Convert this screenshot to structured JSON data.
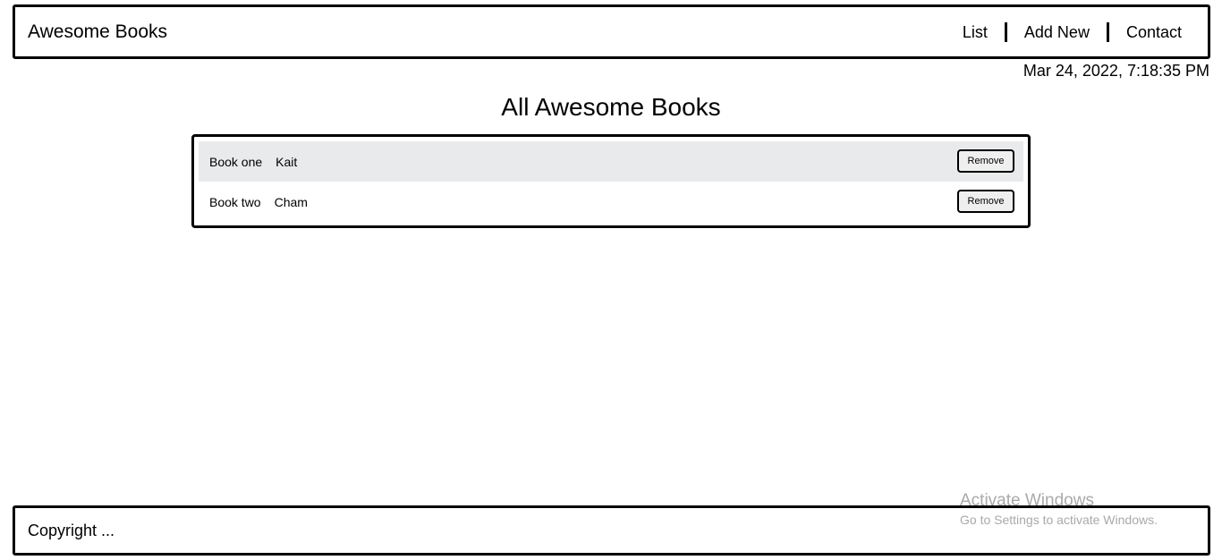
{
  "header": {
    "brand": "Awesome Books",
    "nav": [
      {
        "label": "List"
      },
      {
        "label": "Add New"
      },
      {
        "label": "Contact"
      }
    ]
  },
  "datetime": "Mar 24, 2022, 7:18:35 PM",
  "main": {
    "title": "All Awesome Books",
    "books": [
      {
        "title": "Book one",
        "author": "Kait",
        "remove_label": "Remove"
      },
      {
        "title": "Book two",
        "author": "Cham",
        "remove_label": "Remove"
      }
    ]
  },
  "footer": {
    "copyright": "Copyright ..."
  },
  "watermark": {
    "title": "Activate Windows",
    "subtitle": "Go to Settings to activate Windows."
  }
}
